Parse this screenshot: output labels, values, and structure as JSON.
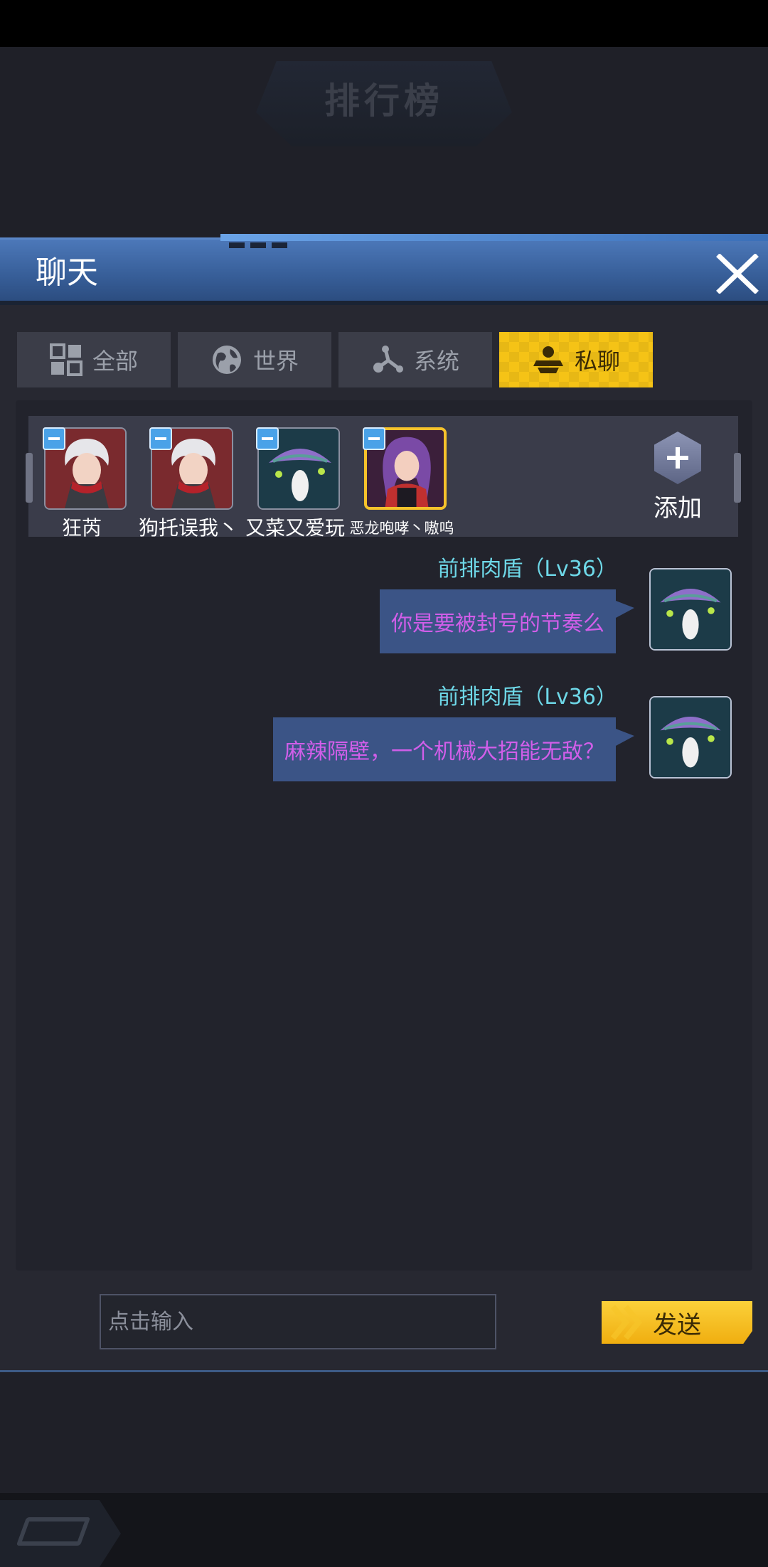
{
  "background": {
    "title": "排行榜"
  },
  "dialog": {
    "title": "聊天"
  },
  "tabs": [
    {
      "label": "全部",
      "icon": "grid-icon",
      "active": false
    },
    {
      "label": "世界",
      "icon": "globe-icon",
      "active": false
    },
    {
      "label": "系统",
      "icon": "nodes-icon",
      "active": false
    },
    {
      "label": "私聊",
      "icon": "private-chat-icon",
      "active": true
    }
  ],
  "friends": [
    {
      "name": "狂芮",
      "avatar": "white-haired-fighter-avatar",
      "selected": false
    },
    {
      "name": "狗托误我丶",
      "avatar": "white-haired-fighter-avatar",
      "selected": false
    },
    {
      "name": "又菜又爱玩",
      "avatar": "mushroom-spirit-avatar",
      "selected": false
    },
    {
      "name": "恶龙咆哮丶嗷呜",
      "avatar": "purple-haired-girl-avatar",
      "selected": true
    }
  ],
  "add_friend": {
    "label": "添加",
    "icon": "plus-icon"
  },
  "messages": [
    {
      "sender": "前排肉盾（Lv36）",
      "text": "你是要被封号的节奏么",
      "avatar": "mushroom-spirit-avatar"
    },
    {
      "sender": "前排肉盾（Lv36）",
      "text": "麻辣隔壁，一个机械大招能无敌？",
      "avatar": "mushroom-spirit-avatar"
    }
  ],
  "input": {
    "placeholder": "点击输入"
  },
  "send_button": {
    "label": "发送"
  },
  "colors": {
    "header_blue": "#4c78b9",
    "active_tab_yellow": "#f5c316",
    "sender_cyan": "#6ed8e8",
    "message_purple": "#d15ee9",
    "bubble_blue": "#3b5486",
    "minus_blue": "#4aa2e8"
  }
}
